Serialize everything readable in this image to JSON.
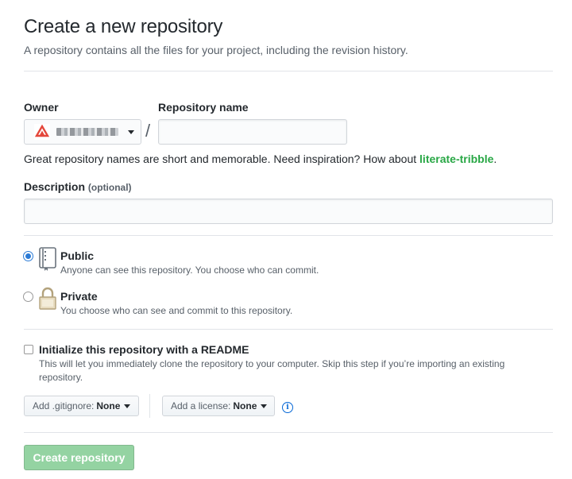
{
  "header": {
    "title": "Create a new repository",
    "subtitle": "A repository contains all the files for your project, including the revision history."
  },
  "owner": {
    "label": "Owner",
    "selected_avatar_icon": "org-avatar-icon"
  },
  "repo_name": {
    "label": "Repository name",
    "separator": "/",
    "value": "",
    "placeholder": ""
  },
  "hint": {
    "text": "Great repository names are short and memorable. Need inspiration? How about ",
    "suggestion": "literate-tribble",
    "end": "."
  },
  "description": {
    "label": "Description",
    "optional": "(optional)",
    "value": "",
    "placeholder": ""
  },
  "visibility": {
    "public": {
      "title": "Public",
      "note": "Anyone can see this repository. You choose who can commit.",
      "checked": true,
      "icon": "repo-book-icon"
    },
    "private": {
      "title": "Private",
      "note": "You choose who can see and commit to this repository.",
      "checked": false,
      "icon": "lock-icon"
    }
  },
  "readme": {
    "label": "Initialize this repository with a README",
    "note": "This will let you immediately clone the repository to your computer. Skip this step if you’re importing an existing repository.",
    "checked": false
  },
  "gitignore": {
    "label": "Add .gitignore:",
    "value": "None"
  },
  "license": {
    "label": "Add a license:",
    "value": "None"
  },
  "submit": {
    "label": "Create repository",
    "disabled": true
  },
  "colors": {
    "suggestion_green": "#28a745",
    "radio_blue": "#2b7bd6",
    "create_button_disabled": "#94d3a2",
    "info_blue": "#0366d6"
  }
}
